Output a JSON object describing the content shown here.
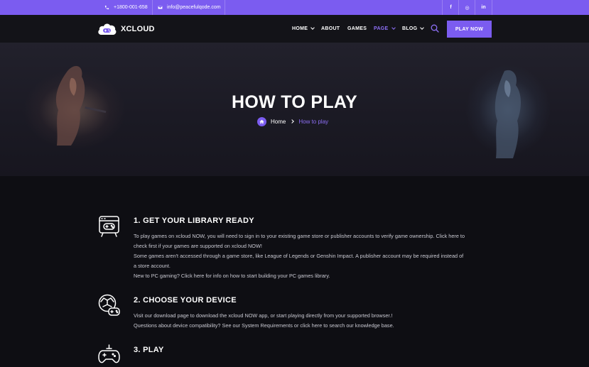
{
  "topbar": {
    "phone": "+1800-001-658",
    "email": "info@peacefulqode.com",
    "social": [
      "f",
      "◎",
      "in"
    ]
  },
  "header": {
    "logo_text": "XCLOUD",
    "nav": [
      {
        "label": "HOME",
        "dropdown": true
      },
      {
        "label": "ABOUT",
        "dropdown": false
      },
      {
        "label": "GAMES",
        "dropdown": false
      },
      {
        "label": "PAGE",
        "dropdown": true,
        "active": true
      },
      {
        "label": "BLOG",
        "dropdown": true
      }
    ],
    "cta": "PLAY NOW"
  },
  "hero": {
    "title": "HOW TO PLAY",
    "breadcrumb_home": "Home",
    "breadcrumb_current": "How to play"
  },
  "steps": [
    {
      "title": "1. GET YOUR LIBRARY READY",
      "icon": "library-icon",
      "lines": [
        "To play games on xcloud NOW, you will need to sign in to your existing game store or publisher accounts to verify game ownership. Click here to",
        "check first if your games are supported on xcloud NOW!",
        "Some games aren't accessed through a game store, like League of Legends or Genshin Impact. A publisher account may be required instead of",
        "a store account.",
        "New to PC gaming? Click here for info on how to start building your PC games library."
      ]
    },
    {
      "title": "2. CHOOSE YOUR DEVICE",
      "icon": "device-icon",
      "lines": [
        "Visit our download page to download the xcloud NOW app, or start playing directly from your supported browser.!",
        "Questions about device compatibility? See our System Requirements or click here to search our knowledge base."
      ]
    },
    {
      "title": "3. PLAY",
      "icon": "gamepad-icon",
      "lines": []
    }
  ],
  "colors": {
    "accent": "#7b5cf0",
    "background": "#0e0e13",
    "header": "#131318"
  }
}
